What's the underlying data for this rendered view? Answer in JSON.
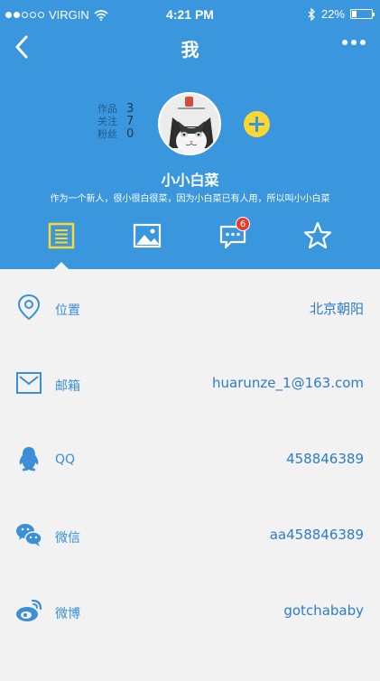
{
  "status_bar": {
    "carrier": "VIRGIN",
    "time": "4:21 PM",
    "battery": "22%",
    "battery_level": 0.22
  },
  "nav": {
    "title": "我"
  },
  "profile": {
    "stats": [
      {
        "label": "作品",
        "value": "3"
      },
      {
        "label": "关注",
        "value": "7"
      },
      {
        "label": "粉丝",
        "value": "0"
      }
    ],
    "name": "小小白菜",
    "bio": "作为一个新人，很小很白很菜，因为小白菜已有人用，所以叫小小白菜"
  },
  "tabs": [
    {
      "name": "posts",
      "icon": "document-icon",
      "active": true
    },
    {
      "name": "photos",
      "icon": "image-icon"
    },
    {
      "name": "messages",
      "icon": "chat-icon",
      "badge": "6"
    },
    {
      "name": "favorites",
      "icon": "star-icon"
    }
  ],
  "info": [
    {
      "icon": "location-icon",
      "label": "位置",
      "value": "北京朝阳"
    },
    {
      "icon": "mail-icon",
      "label": "邮箱",
      "value": "huarunze_1@163.com"
    },
    {
      "icon": "qq-icon",
      "label": "QQ",
      "value": "458846389"
    },
    {
      "icon": "wechat-icon",
      "label": "微信",
      "value": "aa458846389"
    },
    {
      "icon": "weibo-icon",
      "label": "微博",
      "value": "gotchababy"
    }
  ],
  "colors": {
    "primary": "#3a97dd",
    "accent": "#ffd62f",
    "badge": "#e63a30",
    "text_blue": "#2d7cc7"
  }
}
